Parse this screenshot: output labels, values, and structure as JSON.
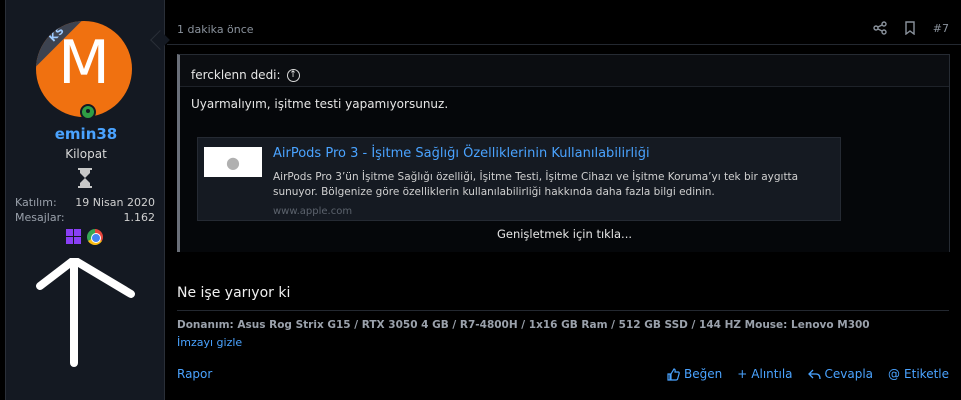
{
  "user": {
    "avatar_letter": "M",
    "avatar_color": "#f07110",
    "ribbon_text": "KS",
    "username": "emin38",
    "title": "Kilopat",
    "stats": [
      {
        "label": "Katılım:",
        "value": "19 Nisan 2020"
      },
      {
        "label": "Mesajlar:",
        "value": "1.162"
      }
    ]
  },
  "post": {
    "time": "1 dakika önce",
    "number": "#7"
  },
  "quote": {
    "author": "fercklenn dedi:",
    "text": "Uyarmalıyım, işitme testi yapamıyorsunuz.",
    "embed": {
      "title": "AirPods Pro 3 - İşitme Sağlığı Özelliklerinin Kullanılabilirliği",
      "description": "AirPods Pro 3’ün İşitme Sağlığı özelliği, İşitme Testi, İşitme Cihazı ve İşitme Koruma’yı tek bir aygıtta sunuyor. Bölgenize göre özelliklerin kullanılabilirliği hakkında daha fazla bilgi edinin.",
      "url": "www.apple.com"
    },
    "expand_label": "Genişletmek için tıkla..."
  },
  "body": {
    "text": "Ne işe yarıyor ki"
  },
  "signature": {
    "text": "Donanım: Asus Rog Strix G15 / RTX 3050 4 GB / R7-4800H / 1x16 GB Ram / 512 GB SSD / 144 HZ Mouse: Lenovo M300",
    "hide_label": "İmzayı gizle"
  },
  "footer": {
    "report": "Rapor",
    "like": "Beğen",
    "quote": "Alıntıla",
    "reply": "Cevapla",
    "tag": "Etiketle"
  },
  "icons": [
    "share-icon",
    "bookmark-icon",
    "hourglass-icon",
    "windows-icon",
    "chrome-icon",
    "thumbs-up-icon",
    "reply-icon",
    "at-icon"
  ]
}
